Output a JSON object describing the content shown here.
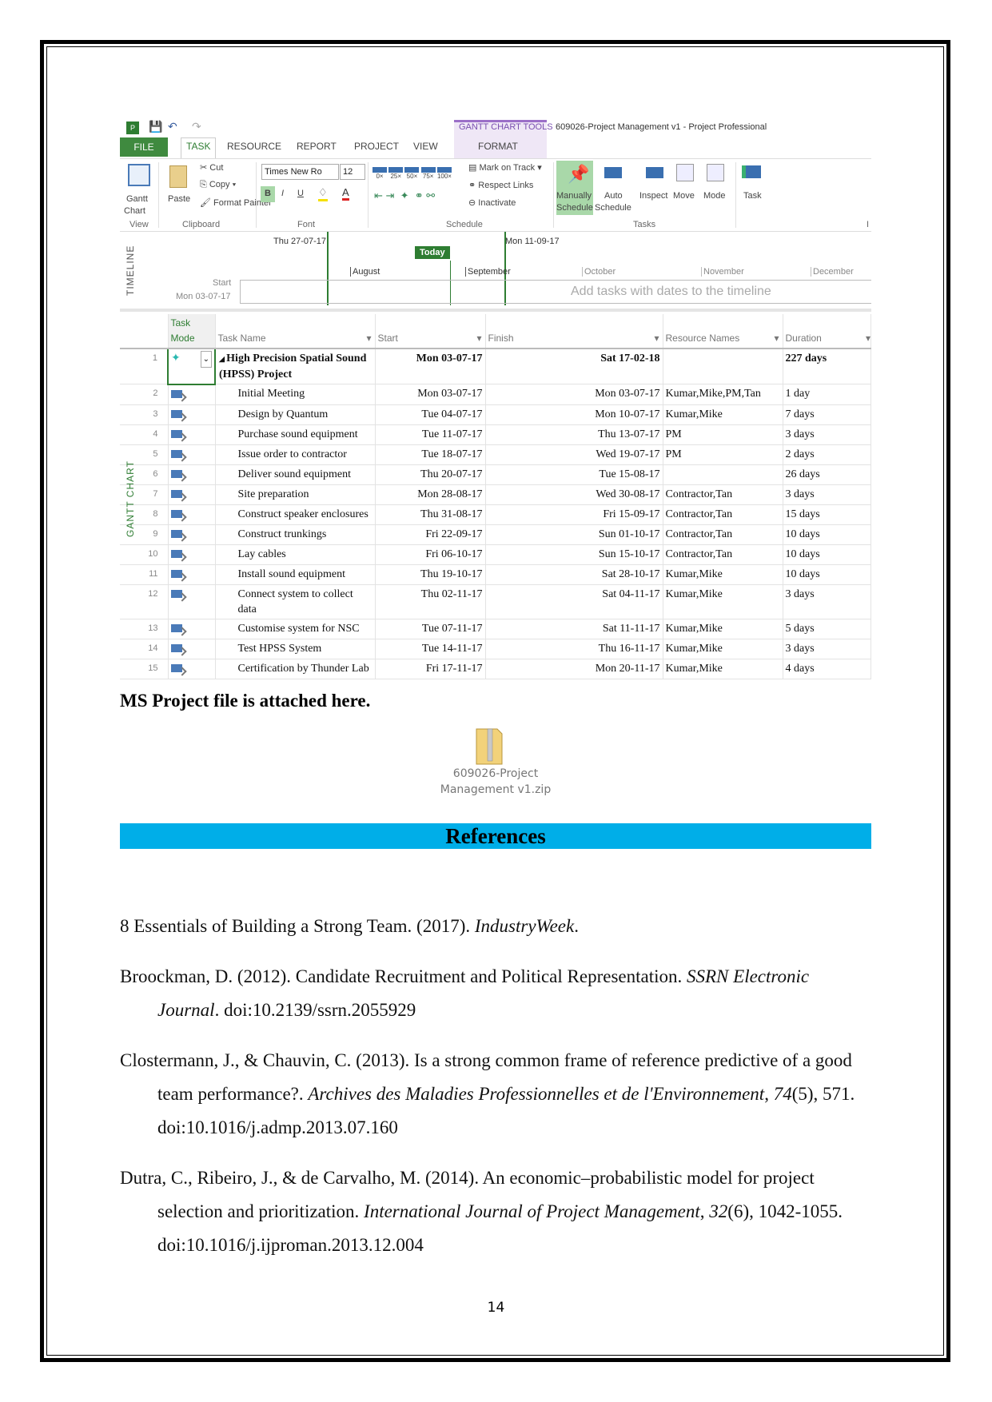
{
  "window": {
    "context_tab": "GANTT CHART TOOLS",
    "title": "609026-Project Management v1 - Project Professional"
  },
  "tabs": [
    "FILE",
    "TASK",
    "RESOURCE",
    "REPORT",
    "PROJECT",
    "VIEW",
    "FORMAT"
  ],
  "ribbon": {
    "view": {
      "gantt": "Gantt",
      "chart": "Chart",
      "group": "View"
    },
    "clipboard": {
      "paste": "Paste",
      "cut": "Cut",
      "copy": "Copy",
      "format_painter": "Format Painter",
      "group": "Clipboard"
    },
    "font": {
      "family": "Times New Ro",
      "size": "12",
      "bold": "B",
      "italic": "I",
      "underline": "U",
      "color": "A",
      "group": "Font"
    },
    "schedule": {
      "pct": [
        "0×",
        "25×",
        "50×",
        "75×",
        "100×"
      ],
      "mark_on_track": "Mark on Track",
      "respect_links": "Respect Links",
      "inactivate": "Inactivate",
      "group": "Schedule"
    },
    "tasks": {
      "manually": "Manually",
      "manually2": "Schedule",
      "auto": "Auto",
      "auto2": "Schedule",
      "inspect": "Inspect",
      "move": "Move",
      "mode": "Mode",
      "group": "Tasks"
    },
    "insert": {
      "task": "Task",
      "group": "I"
    }
  },
  "timeline": {
    "label": "TIMELINE",
    "left_date": "Thu 27-07-17",
    "right_date": "Mon 11-09-17",
    "today": "Today",
    "months": [
      "August",
      "September",
      "October",
      "November",
      "December"
    ],
    "start_label": "Start",
    "start_date": "Mon 03-07-17",
    "placeholder": "Add tasks with dates to the timeline"
  },
  "gantt": {
    "label": "GANTT CHART",
    "headers": {
      "mode": "Task Mode",
      "name": "Task Name",
      "start": "Start",
      "finish": "Finish",
      "resources": "Resource Names",
      "duration": "Duration"
    },
    "rows": [
      {
        "id": "1",
        "name": "High Precision Spatial Sound (HPSS) Project",
        "start": "Mon 03-07-17",
        "finish": "Sat 17-02-18",
        "resources": "",
        "duration": "227 days",
        "summary": true
      },
      {
        "id": "2",
        "name": "Initial Meeting",
        "start": "Mon 03-07-17",
        "finish": "Mon 03-07-17",
        "resources": "Kumar,Mike,PM,Tan",
        "duration": "1 day"
      },
      {
        "id": "3",
        "name": "Design by Quantum",
        "start": "Tue 04-07-17",
        "finish": "Mon 10-07-17",
        "resources": "Kumar,Mike",
        "duration": "7 days"
      },
      {
        "id": "4",
        "name": "Purchase sound equipment",
        "start": "Tue 11-07-17",
        "finish": "Thu 13-07-17",
        "resources": "PM",
        "duration": "3 days"
      },
      {
        "id": "5",
        "name": "Issue order to contractor",
        "start": "Tue 18-07-17",
        "finish": "Wed 19-07-17",
        "resources": "PM",
        "duration": "2 days"
      },
      {
        "id": "6",
        "name": "Deliver sound equipment",
        "start": "Thu 20-07-17",
        "finish": "Tue 15-08-17",
        "resources": "",
        "duration": "26 days"
      },
      {
        "id": "7",
        "name": "Site preparation",
        "start": "Mon 28-08-17",
        "finish": "Wed 30-08-17",
        "resources": "Contractor,Tan",
        "duration": "3 days"
      },
      {
        "id": "8",
        "name": "Construct speaker enclosures",
        "start": "Thu 31-08-17",
        "finish": "Fri 15-09-17",
        "resources": "Contractor,Tan",
        "duration": "15 days"
      },
      {
        "id": "9",
        "name": "Construct trunkings",
        "start": "Fri 22-09-17",
        "finish": "Sun 01-10-17",
        "resources": "Contractor,Tan",
        "duration": "10 days"
      },
      {
        "id": "10",
        "name": "Lay cables",
        "start": "Fri 06-10-17",
        "finish": "Sun 15-10-17",
        "resources": "Contractor,Tan",
        "duration": "10 days"
      },
      {
        "id": "11",
        "name": "Install sound equipment",
        "start": "Thu 19-10-17",
        "finish": "Sat 28-10-17",
        "resources": "Kumar,Mike",
        "duration": "10 days"
      },
      {
        "id": "12",
        "name": "Connect system to collect data",
        "start": "Thu 02-11-17",
        "finish": "Sat 04-11-17",
        "resources": "Kumar,Mike",
        "duration": "3 days"
      },
      {
        "id": "13",
        "name": "Customise system for NSC",
        "start": "Tue 07-11-17",
        "finish": "Sat 11-11-17",
        "resources": "Kumar,Mike",
        "duration": "5 days"
      },
      {
        "id": "14",
        "name": "Test HPSS System",
        "start": "Tue 14-11-17",
        "finish": "Thu 16-11-17",
        "resources": "Kumar,Mike",
        "duration": "3 days"
      },
      {
        "id": "15",
        "name": "Certification by Thunder Lab",
        "start": "Fri 17-11-17",
        "finish": "Mon 20-11-17",
        "resources": "Kumar,Mike",
        "duration": "4 days"
      }
    ]
  },
  "doc": {
    "caption": "MS Project file is attached here.",
    "attachment": {
      "line1": "609026-Project",
      "line2": "Management v1.zip"
    },
    "references_heading": "References",
    "references": [
      {
        "pre": "8 Essentials of Building a Strong Team. (2017). ",
        "ital": "IndustryWeek",
        "post": "."
      },
      {
        "pre": "Broockman, D. (2012). Candidate Recruitment and Political Representation. ",
        "ital": "SSRN Electronic Journal",
        "post": ". doi:10.2139/ssrn.2055929"
      },
      {
        "pre": "Clostermann, J., & Chauvin, C. (2013). Is a strong common frame of reference predictive of a good team performance?. ",
        "ital": "Archives des Maladies Professionnelles et de l'Environnement",
        "post": ", ",
        "ital2": "74",
        "post2": "(5), 571. doi:10.1016/j.admp.2013.07.160"
      },
      {
        "pre": "Dutra, C., Ribeiro, J., & de Carvalho, M. (2014). An economic–probabilistic model for project selection and prioritization. ",
        "ital": "International Journal of Project Management",
        "post": ", ",
        "ital2": "32",
        "post2": "(6), 1042-1055. doi:10.1016/j.ijproman.2013.12.004"
      }
    ],
    "page_number": "14"
  },
  "colors": {
    "file_tab": "#3f8a3f",
    "gantt_tools": "#9b6fc8",
    "timeline_today": "#2e7d32",
    "references_bar": "#00aee8",
    "task_mode_icon": "#4a7ab8"
  }
}
